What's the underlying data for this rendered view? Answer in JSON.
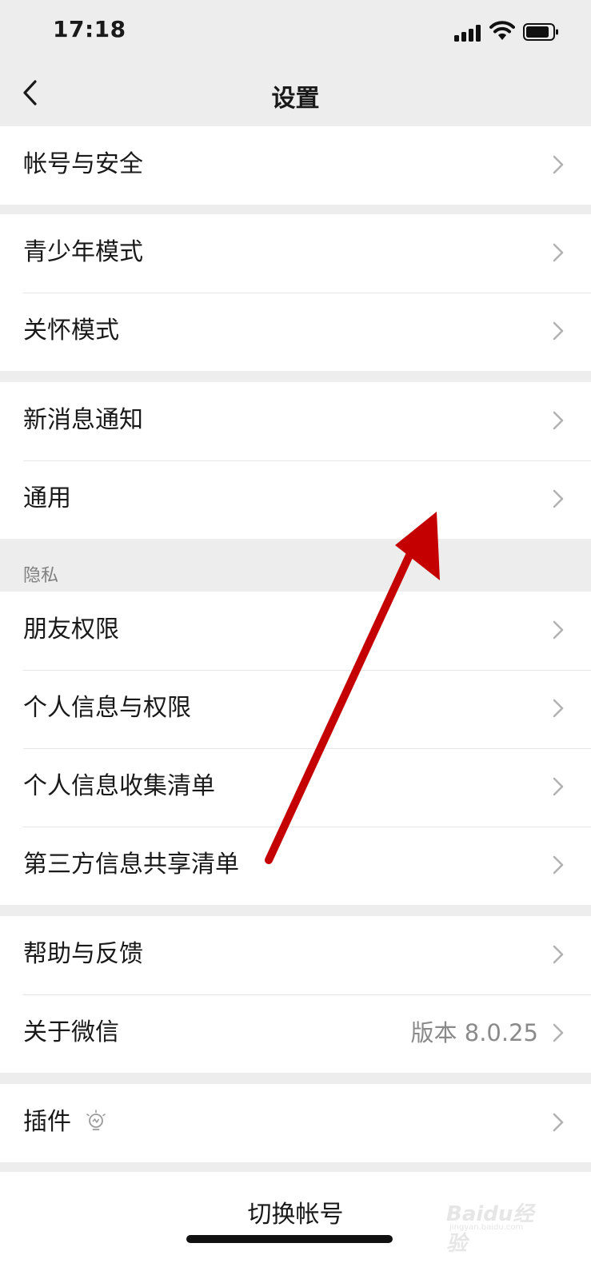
{
  "status_bar": {
    "time": "17:18"
  },
  "nav": {
    "title": "设置"
  },
  "groups": {
    "account": {
      "items": [
        "帐号与安全"
      ]
    },
    "modes": {
      "items": [
        "青少年模式",
        "关怀模式"
      ]
    },
    "general": {
      "items": [
        "新消息通知",
        "通用"
      ]
    },
    "privacy": {
      "section_title": "隐私",
      "items": [
        "朋友权限",
        "个人信息与权限",
        "个人信息收集清单",
        "第三方信息共享清单"
      ]
    },
    "about": {
      "items": [
        "帮助与反馈",
        "关于微信"
      ],
      "version": "版本 8.0.25"
    },
    "plugins": {
      "items": [
        "插件"
      ]
    }
  },
  "switch_account": {
    "label": "切换帐号"
  },
  "watermark": {
    "text": "Baidu经验",
    "sub": "jingyan.baidu.com"
  },
  "annotation": {
    "color": "#c40000"
  },
  "icons": {
    "back": "chevron-left-icon",
    "row_arrow": "chevron-right-icon",
    "plugin": "lightbulb-icon"
  }
}
